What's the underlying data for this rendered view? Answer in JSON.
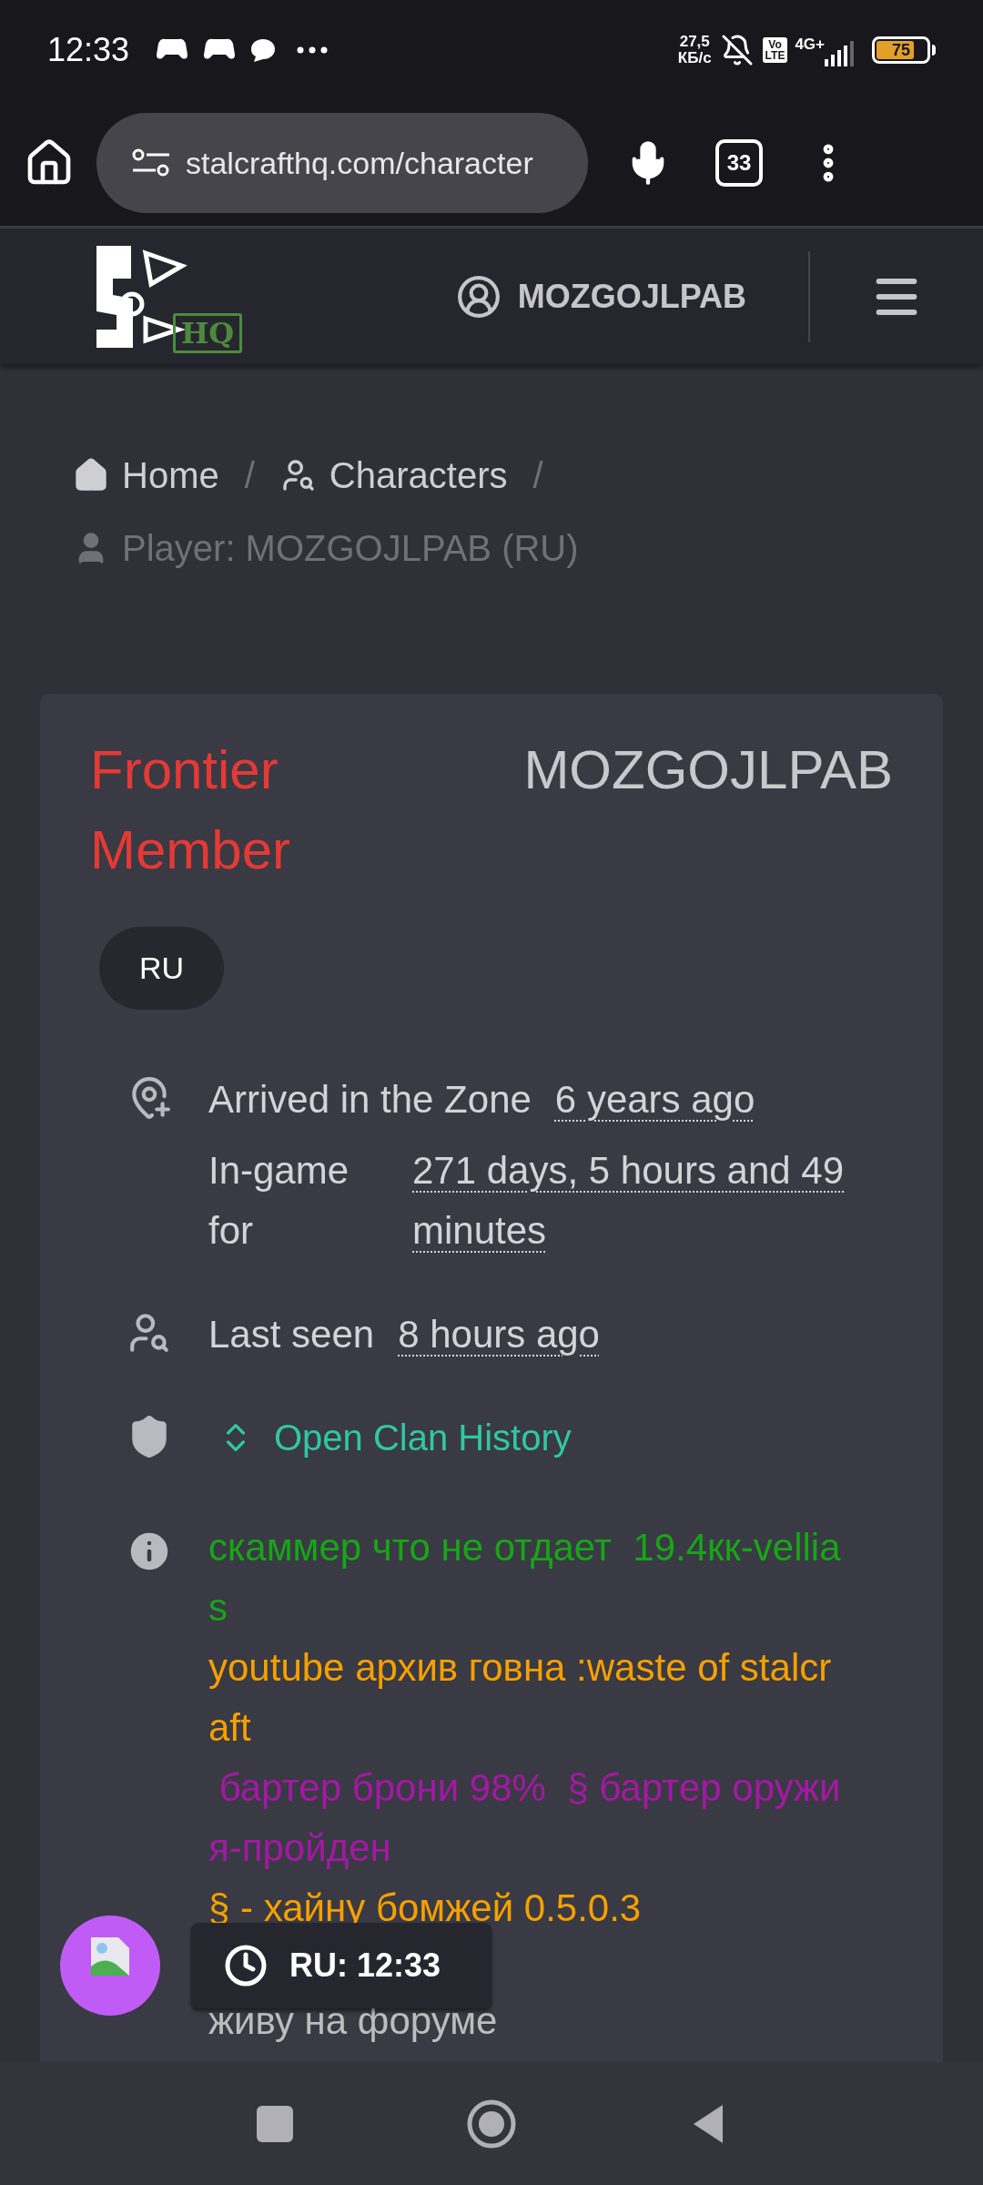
{
  "status_bar": {
    "time": "12:33",
    "net_speed": "27,5",
    "net_unit": "КБ/с",
    "volte": "Vo\nLTE",
    "network": "4G+",
    "battery": "75"
  },
  "browser": {
    "url": "stalcrafthq.com/character",
    "tab_count": "33"
  },
  "header": {
    "logo_text": "HQ",
    "user": "MOZGOJLPAB"
  },
  "breadcrumb": [
    {
      "label": "Home",
      "kind": "home",
      "current": false,
      "separator": "/"
    },
    {
      "label": "Characters",
      "kind": "search-user",
      "current": false,
      "separator": "/"
    },
    {
      "label": "Player: MOZGOJLPAB (RU)",
      "kind": "user",
      "current": true
    }
  ],
  "profile": {
    "rank": "Frontier Member",
    "name": "MOZGOJLPAB",
    "region": "RU",
    "details": [
      {
        "kind": "arrived",
        "label": "Arrived in the Zone",
        "value": "6 years ago"
      },
      {
        "kind": "ingame",
        "label": "In-game for",
        "value": "271 days, 5 hours and 49 minutes"
      },
      {
        "kind": "lastseen",
        "label": "Last seen",
        "value": "8 hours ago"
      },
      {
        "kind": "clan",
        "label": "Open Clan History"
      }
    ],
    "notes": [
      {
        "text": "скаммер что не отдает  19.4кк-vellias",
        "color": "#18a418"
      },
      {
        "text": "youtube архив говна :waste of stalcraft",
        "color": "#f5a000"
      },
      {
        "text": " бартер брони 98%  § бартер оружия-пройден",
        "color": "#a418a4"
      },
      {
        "text": "§ - хайну бомжей 0.5.0.3",
        "color": "#f5a000"
      },
      {
        "text": "живу на форуме",
        "color": "#bdbdbd"
      }
    ]
  },
  "clock_badge": {
    "text": "RU: 12:33"
  }
}
